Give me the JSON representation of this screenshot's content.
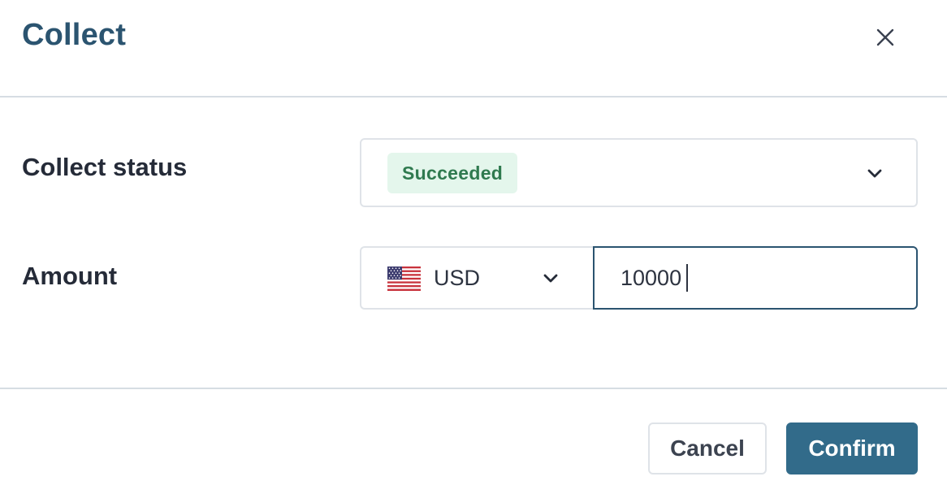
{
  "modal": {
    "title": "Collect",
    "close_icon": "close-icon"
  },
  "form": {
    "collect_status": {
      "label": "Collect status",
      "selected_value": "Succeeded",
      "badge_bg": "#e4f6ec",
      "badge_color": "#2f7a4f",
      "dropdown_icon": "chevron-down-icon"
    },
    "amount": {
      "label": "Amount",
      "currency": "USD",
      "currency_flag_icon": "us-flag-icon",
      "dropdown_icon": "chevron-down-icon",
      "value": "10000"
    }
  },
  "footer": {
    "cancel_label": "Cancel",
    "confirm_label": "Confirm"
  },
  "colors": {
    "title": "#2b5470",
    "primary": "#326b8a",
    "input_focus_border": "#2b5470",
    "divider": "#d6dde3"
  }
}
